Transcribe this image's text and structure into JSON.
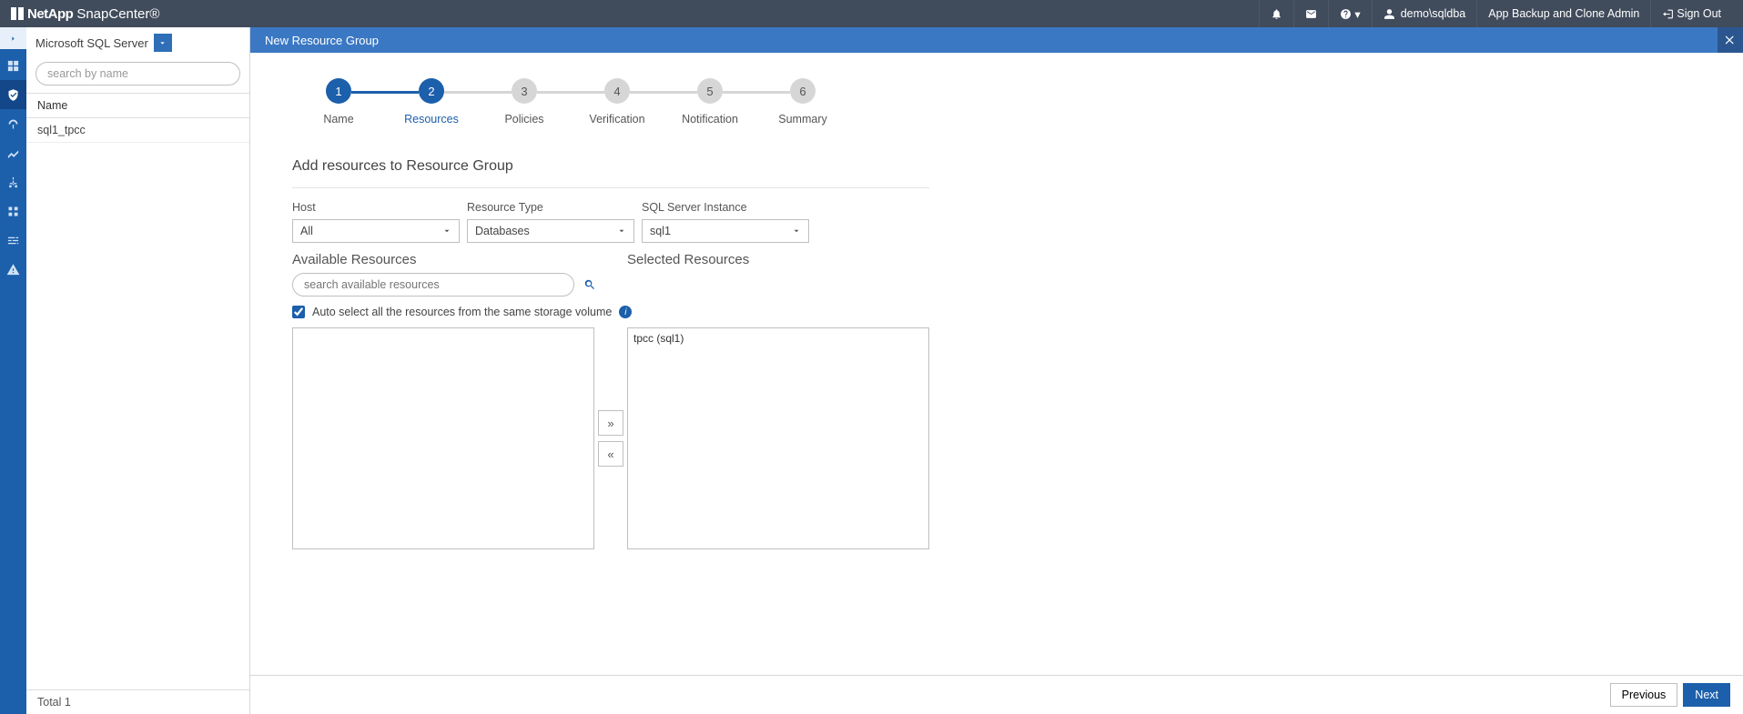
{
  "brand": {
    "company": "NetApp",
    "product": "SnapCenter®"
  },
  "topbar": {
    "username": "demo\\sqldba",
    "role": "App Backup and Clone Admin",
    "signout": "Sign Out"
  },
  "side": {
    "selector_label": "Microsoft SQL Server",
    "search_placeholder": "search by name",
    "col_name": "Name",
    "items": [
      "sql1_tpcc"
    ],
    "total_label": "Total 1"
  },
  "title": "New Resource Group",
  "steps": [
    {
      "num": "1",
      "label": "Name",
      "state": "done"
    },
    {
      "num": "2",
      "label": "Resources",
      "state": "active"
    },
    {
      "num": "3",
      "label": "Policies",
      "state": "todo"
    },
    {
      "num": "4",
      "label": "Verification",
      "state": "todo"
    },
    {
      "num": "5",
      "label": "Notification",
      "state": "todo"
    },
    {
      "num": "6",
      "label": "Summary",
      "state": "todo"
    }
  ],
  "form": {
    "section_title": "Add resources to Resource Group",
    "host_label": "Host",
    "host_value": "All",
    "type_label": "Resource Type",
    "type_value": "Databases",
    "instance_label": "SQL Server Instance",
    "instance_value": "sql1",
    "available_title": "Available Resources",
    "selected_title": "Selected Resources",
    "search_placeholder": "search available resources",
    "checkbox_label": "Auto select all the resources from the same storage volume",
    "checkbox_checked": true,
    "selected_items": [
      "tpcc (sql1)"
    ],
    "move_right": "»",
    "move_left": "«"
  },
  "footer": {
    "prev": "Previous",
    "next": "Next"
  }
}
